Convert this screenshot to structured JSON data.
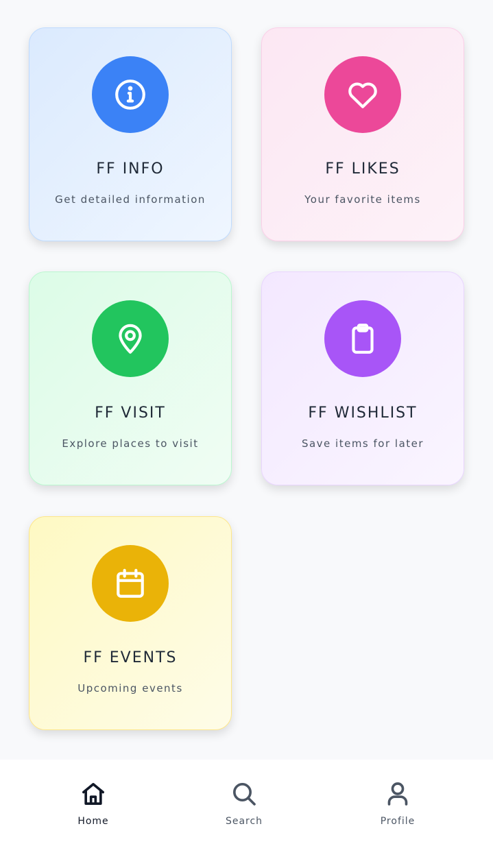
{
  "cards": [
    {
      "title": "FF INFO",
      "subtitle": "Get detailed information",
      "icon": "info-icon",
      "color": "#3b82f6"
    },
    {
      "title": "FF LIKES",
      "subtitle": "Your favorite items",
      "icon": "heart-icon",
      "color": "#ec4899"
    },
    {
      "title": "FF VISIT",
      "subtitle": "Explore places to visit",
      "icon": "map-pin-icon",
      "color": "#22c55e"
    },
    {
      "title": "FF WISHLIST",
      "subtitle": "Save items for later",
      "icon": "clipboard-icon",
      "color": "#a855f7"
    },
    {
      "title": "FF EVENTS",
      "subtitle": "Upcoming events",
      "icon": "calendar-icon",
      "color": "#eab308"
    }
  ],
  "nav": {
    "items": [
      {
        "label": "Home",
        "icon": "home-icon",
        "active": true
      },
      {
        "label": "Search",
        "icon": "search-icon",
        "active": false
      },
      {
        "label": "Profile",
        "icon": "user-icon",
        "active": false
      }
    ]
  }
}
